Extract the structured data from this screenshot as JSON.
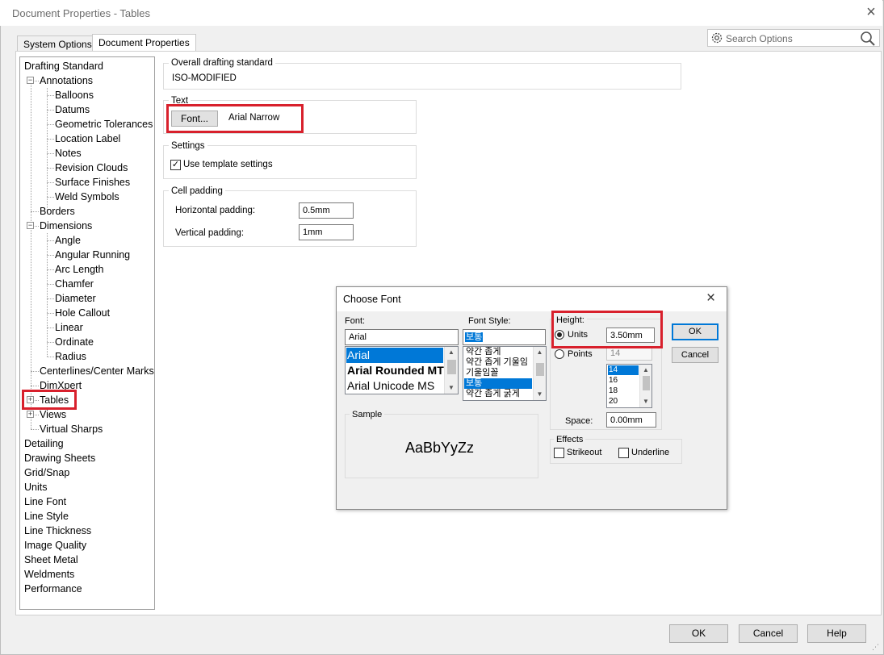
{
  "window": {
    "title": "Document Properties - Tables",
    "close_icon": "×"
  },
  "tabs": [
    {
      "label": "System Options"
    },
    {
      "label": "Document Properties"
    }
  ],
  "search": {
    "placeholder": "Search Options"
  },
  "tree": {
    "items": [
      "Drafting Standard",
      "Annotations",
      "Balloons",
      "Datums",
      "Geometric Tolerances",
      "Location Label",
      "Notes",
      "Revision Clouds",
      "Surface Finishes",
      "Weld Symbols",
      "Borders",
      "Dimensions",
      "Angle",
      "Angular Running",
      "Arc Length",
      "Chamfer",
      "Diameter",
      "Hole Callout",
      "Linear",
      "Ordinate",
      "Radius",
      "Centerlines/Center Marks",
      "DimXpert",
      "Tables",
      "Views",
      "Virtual Sharps",
      "Detailing",
      "Drawing Sheets",
      "Grid/Snap",
      "Units",
      "Line Font",
      "Line Style",
      "Line Thickness",
      "Image Quality",
      "Sheet Metal",
      "Weldments",
      "Performance"
    ]
  },
  "overall": {
    "title": "Overall drafting standard",
    "value": "ISO-MODIFIED"
  },
  "text_group": {
    "title": "Text",
    "font_button": "Font...",
    "font_name": "Arial Narrow"
  },
  "settings": {
    "title": "Settings",
    "use_template": "Use template settings",
    "checked": true
  },
  "cell_padding": {
    "title": "Cell padding",
    "h_label": "Horizontal padding:",
    "h_value": "0.5mm",
    "v_label": "Vertical padding:",
    "v_value": "1mm"
  },
  "dialog": {
    "title": "Choose Font",
    "font_label": "Font:",
    "font_value": "Arial",
    "fonts": [
      "Arial",
      "Arial Rounded MT",
      "Arial Unicode MS"
    ],
    "style_label": "Font Style:",
    "style_value": "보통",
    "styles": [
      "약간 좁게",
      "약간 좁게 기울임",
      "기울임꼴",
      "보통",
      "약간 좁게 굵게"
    ],
    "height_title": "Height:",
    "units_label": "Units",
    "units_value": "3.50mm",
    "points_label": "Points",
    "points_value": "14",
    "points_list": [
      "14",
      "16",
      "18",
      "20"
    ],
    "space_label": "Space:",
    "space_value": "0.00mm",
    "effects_title": "Effects",
    "strikeout": "Strikeout",
    "underline": "Underline",
    "sample_title": "Sample",
    "sample_text": "AaBbYyZz",
    "ok": "OK",
    "cancel": "Cancel",
    "close_icon": "×"
  },
  "bottom": {
    "ok": "OK",
    "cancel": "Cancel",
    "help": "Help"
  },
  "colors": {
    "highlight_red": "#d8202c",
    "selection_blue": "#0078d7"
  }
}
